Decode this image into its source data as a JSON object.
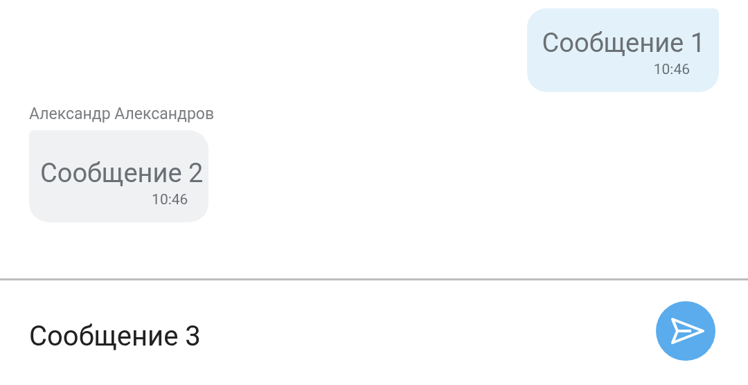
{
  "messages": [
    {
      "kind": "outgoing",
      "text": "Сообщение 1",
      "time": "10:46"
    },
    {
      "kind": "incoming",
      "sender": "Александр Александров",
      "text": "Сообщение 2",
      "time": "10:46"
    }
  ],
  "composer": {
    "value": "Сообщение 3"
  }
}
